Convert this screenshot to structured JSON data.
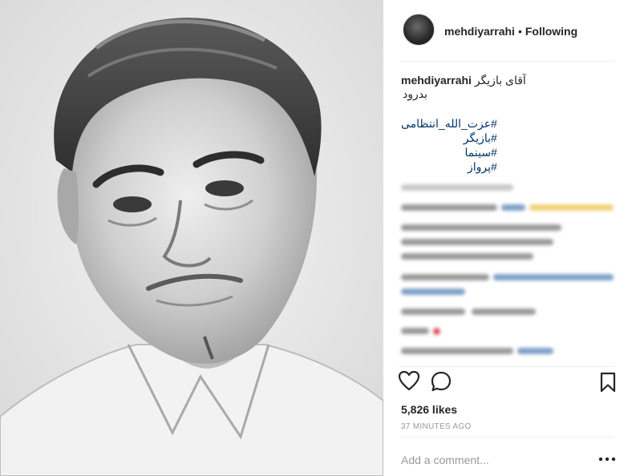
{
  "post": {
    "username": "mehdiyarrahi",
    "separator": "•",
    "follow_status": "Following",
    "caption_user": "mehdiyarrahi",
    "caption_line1": "آقای بازیگر",
    "caption_line2": "بدرود",
    "hashtags": [
      "#عزت_الله_انتظامی",
      "#بازیگر",
      "#سینما",
      "#پرواز"
    ],
    "likes": "5,826 likes",
    "time": "37 MINUTES AGO",
    "add_comment_placeholder": "Add a comment...",
    "icons": {
      "like": "heart-outline-icon",
      "comment": "speech-bubble-icon",
      "save": "bookmark-icon",
      "more": "more-dots-icon"
    },
    "colors": {
      "hashtag": "#003569",
      "meta": "#999999",
      "divider": "#efefef"
    }
  }
}
